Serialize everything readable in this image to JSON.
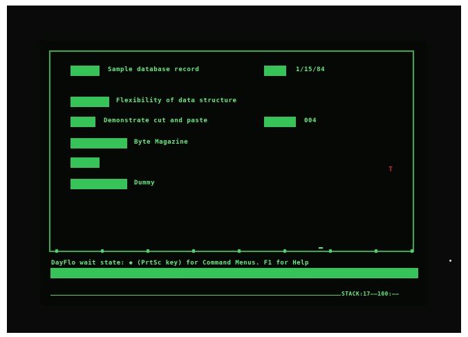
{
  "record": {
    "title": "Sample database record",
    "date": "1/15/84",
    "field2": "Flexibility of data structure",
    "field3": "Demonstrate cut and paste",
    "field3_code": "004",
    "field4": "Byte Magazine",
    "field6": "Dummy"
  },
  "status": {
    "prompt": "DayFlo wait state:  ◆ (PrtSc key) for Command Menus.  F1 for Help",
    "footer": "STACK:17——100:——"
  },
  "colors": {
    "phosphor": "#5ef07c",
    "field": "#36c458",
    "background": "#050805",
    "cursor": "#c02a2a"
  }
}
